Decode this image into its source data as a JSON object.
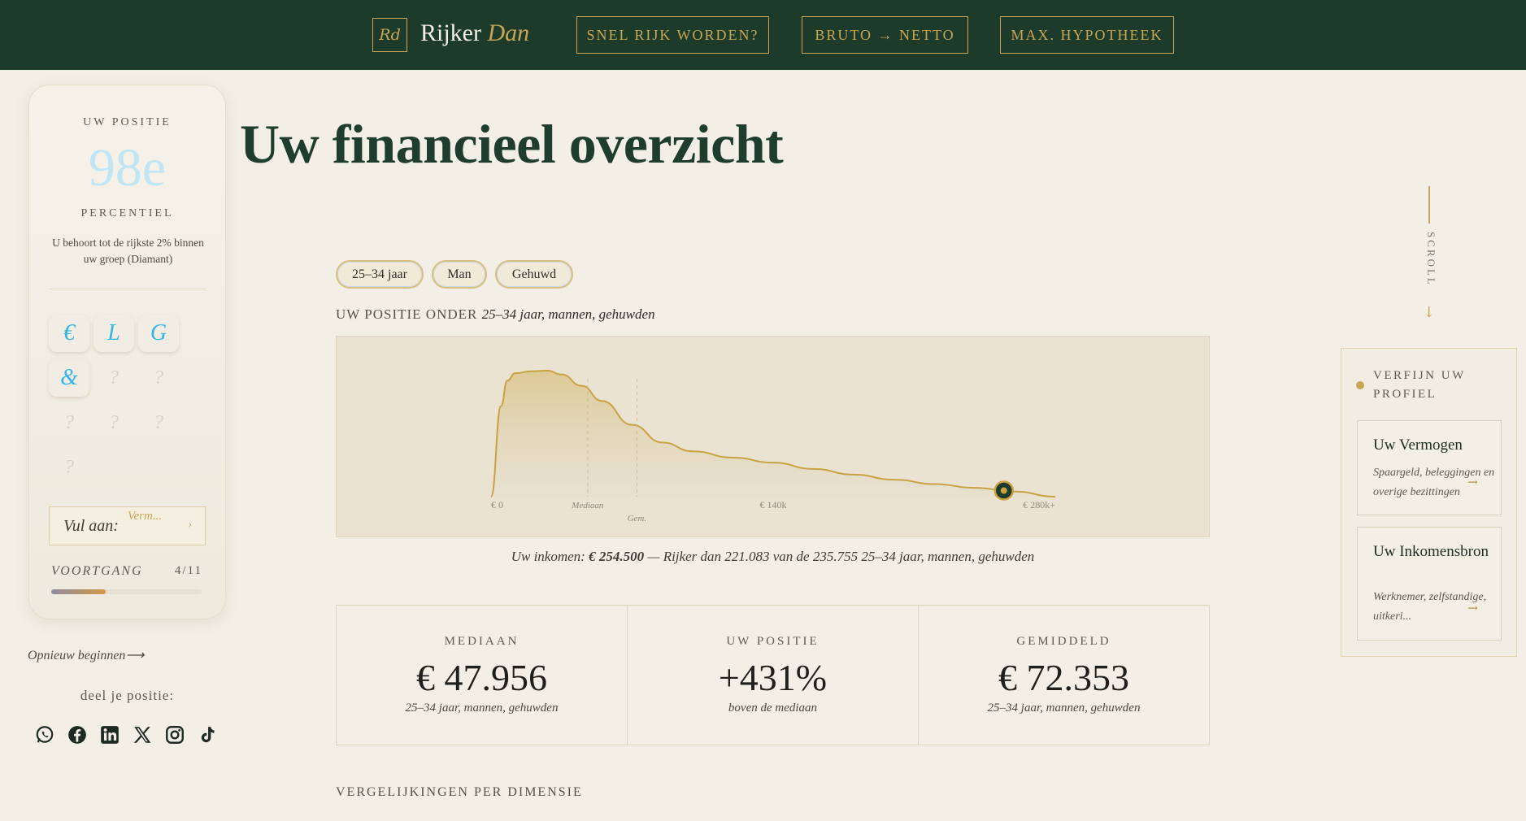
{
  "header": {
    "logo_mark": "Rd",
    "brand_first": "Rijker",
    "brand_second": "Dan",
    "nav": [
      {
        "label": "SNEL RIJK WORDEN?"
      },
      {
        "label": "BRUTO → NETTO"
      },
      {
        "label": "MAX. HYPOTHEEK"
      }
    ]
  },
  "sidebar": {
    "position_label": "UW POSITIE",
    "rank": "98e",
    "percentile_label": "PERCENTIEL",
    "description": "U behoort tot de rijkste 2% binnen uw groep (Diamant)",
    "badges": [
      {
        "glyph": "€",
        "unlocked": true
      },
      {
        "glyph": "L",
        "unlocked": true
      },
      {
        "glyph": "G",
        "unlocked": true
      },
      {
        "glyph": "&",
        "unlocked": true
      },
      {
        "glyph": "?",
        "unlocked": false
      },
      {
        "glyph": "?",
        "unlocked": false
      },
      {
        "glyph": "?",
        "unlocked": false
      },
      {
        "glyph": "?",
        "unlocked": false
      },
      {
        "glyph": "?",
        "unlocked": false
      },
      {
        "glyph": "?",
        "unlocked": false
      }
    ],
    "fill_label": "Vul aan:",
    "fill_value": "Verm...",
    "fill_arrow": "›",
    "progress_label": "VOORTGANG",
    "progress_value": "4/11",
    "progress_fraction": 0.36,
    "restart_label": "Opnieuw beginnen",
    "restart_arrow": "⟶",
    "share_label": "deel je positie:",
    "social_icons": [
      "whatsapp-icon",
      "facebook-icon",
      "linkedin-icon",
      "x-icon",
      "instagram-icon",
      "tiktok-icon"
    ]
  },
  "main": {
    "title": "Uw financieel overzicht",
    "chips": [
      {
        "label": "25–34 jaar"
      },
      {
        "label": "Man"
      },
      {
        "label": "Gehuwd"
      }
    ],
    "position_under_label": "UW POSITIE ONDER",
    "position_under_group": "25–34 jaar, mannen, gehuwden",
    "income_prefix": "Uw inkomen:",
    "income_value": "€ 254.500",
    "income_suffix": "— Rijker dan 221.083 van de 235.755 25–34 jaar, mannen, gehuwden",
    "stats": [
      {
        "label": "MEDIAAN",
        "value": "€ 47.956",
        "sub": "25–34 jaar, mannen, gehuwden"
      },
      {
        "label": "UW POSITIE",
        "value": "+431%",
        "sub": "boven de mediaan"
      },
      {
        "label": "GEMIDDELD",
        "value": "€ 72.353",
        "sub": "25–34 jaar, mannen, gehuwden"
      }
    ],
    "comparisons_header": "VERGELIJKINGEN PER DIMENSIE"
  },
  "chart_data": {
    "type": "area",
    "x_tick_labels": [
      "€ 0",
      "€ 140k",
      "€ 280k+"
    ],
    "x_ticks": [
      0,
      140000,
      280000
    ],
    "xlim": [
      0,
      280000
    ],
    "markers": [
      {
        "label": "Mediaan",
        "x": 47956
      },
      {
        "label": "Gem.",
        "x": 72353
      }
    ],
    "user_point": {
      "x": 254500
    },
    "x": [
      0,
      5000,
      8000,
      12000,
      20000,
      28000,
      35000,
      45000,
      55000,
      70000,
      85000,
      100000,
      120000,
      140000,
      160000,
      180000,
      200000,
      220000,
      240000,
      260000,
      280000
    ],
    "y": [
      0,
      0.72,
      0.92,
      0.98,
      0.995,
      1.0,
      0.97,
      0.88,
      0.76,
      0.57,
      0.43,
      0.36,
      0.31,
      0.27,
      0.22,
      0.175,
      0.135,
      0.1,
      0.07,
      0.04,
      0.0
    ],
    "colors": {
      "line": "#c9a243",
      "fill": "#dcc58a",
      "marker": "#1c3b2a"
    }
  },
  "right_panel": {
    "scroll_label": "SCROLL",
    "scroll_arrow": "↓",
    "refine_title": "VERFIJN UW PROFIEL",
    "cards": [
      {
        "title": "Uw Vermogen",
        "desc": "Spaargeld, beleggingen en overige bezittingen",
        "arrow": "→"
      },
      {
        "title": "Uw Inkomensbron",
        "desc": "Werknemer, zelfstandige, uitkeri...",
        "arrow": "→"
      }
    ]
  },
  "colors": {
    "header_bg": "#1c3b2a",
    "gold": "#c9a653",
    "page_bg": "#f3efe7",
    "rank_color": "#bfe6f4",
    "badge_accent": "#36b5e0"
  }
}
